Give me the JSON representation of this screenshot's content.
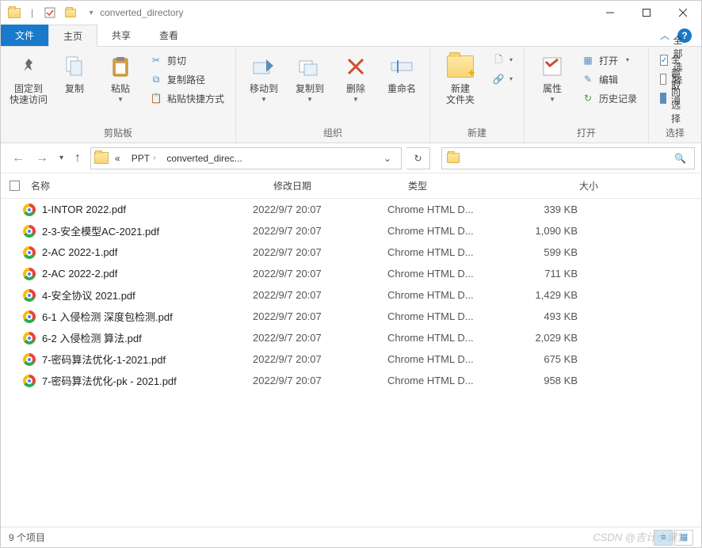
{
  "title": {
    "separator": "|",
    "text": "converted_directory"
  },
  "tabs": {
    "file": "文件",
    "home": "主页",
    "share": "共享",
    "view": "查看"
  },
  "ribbon": {
    "clipboard": {
      "pin": "固定到\n快速访问",
      "copy": "复制",
      "paste": "粘贴",
      "cut": "剪切",
      "copy_path": "复制路径",
      "paste_shortcut": "粘贴快捷方式",
      "label": "剪贴板"
    },
    "organize": {
      "move_to": "移动到",
      "copy_to": "复制到",
      "delete": "删除",
      "rename": "重命名",
      "label": "组织"
    },
    "new": {
      "new_folder": "新建\n文件夹",
      "label": "新建"
    },
    "open": {
      "properties": "属性",
      "open": "打开",
      "edit": "编辑",
      "history": "历史记录",
      "label": "打开"
    },
    "select": {
      "select_all": "全部选择",
      "select_none": "全部取消",
      "invert": "反向选择",
      "label": "选择"
    }
  },
  "breadcrumb": {
    "prefix": "«",
    "parts": [
      "PPT",
      "converted_direc..."
    ]
  },
  "columns": {
    "name": "名称",
    "modified": "修改日期",
    "type": "类型",
    "size": "大小"
  },
  "files": [
    {
      "name": "1-INTOR 2022.pdf",
      "date": "2022/9/7 20:07",
      "type": "Chrome HTML D...",
      "size": "339 KB"
    },
    {
      "name": "2-3-安全模型AC-2021.pdf",
      "date": "2022/9/7 20:07",
      "type": "Chrome HTML D...",
      "size": "1,090 KB"
    },
    {
      "name": "2-AC 2022-1.pdf",
      "date": "2022/9/7 20:07",
      "type": "Chrome HTML D...",
      "size": "599 KB"
    },
    {
      "name": "2-AC 2022-2.pdf",
      "date": "2022/9/7 20:07",
      "type": "Chrome HTML D...",
      "size": "711 KB"
    },
    {
      "name": "4-安全协议 2021.pdf",
      "date": "2022/9/7 20:07",
      "type": "Chrome HTML D...",
      "size": "1,429 KB"
    },
    {
      "name": "6-1 入侵检测 深度包检测.pdf",
      "date": "2022/9/7 20:07",
      "type": "Chrome HTML D...",
      "size": "493 KB"
    },
    {
      "name": "6-2 入侵检测 算法.pdf",
      "date": "2022/9/7 20:07",
      "type": "Chrome HTML D...",
      "size": "2,029 KB"
    },
    {
      "name": "7-密码算法优化-1-2021.pdf",
      "date": "2022/9/7 20:07",
      "type": "Chrome HTML D...",
      "size": "675 KB"
    },
    {
      "name": "7-密码算法优化-pk - 2021.pdf",
      "date": "2022/9/7 20:07",
      "type": "Chrome HTML D...",
      "size": "958 KB"
    }
  ],
  "status": {
    "count": "9 个项目"
  },
  "watermark": "CSDN @吉计小课堂"
}
